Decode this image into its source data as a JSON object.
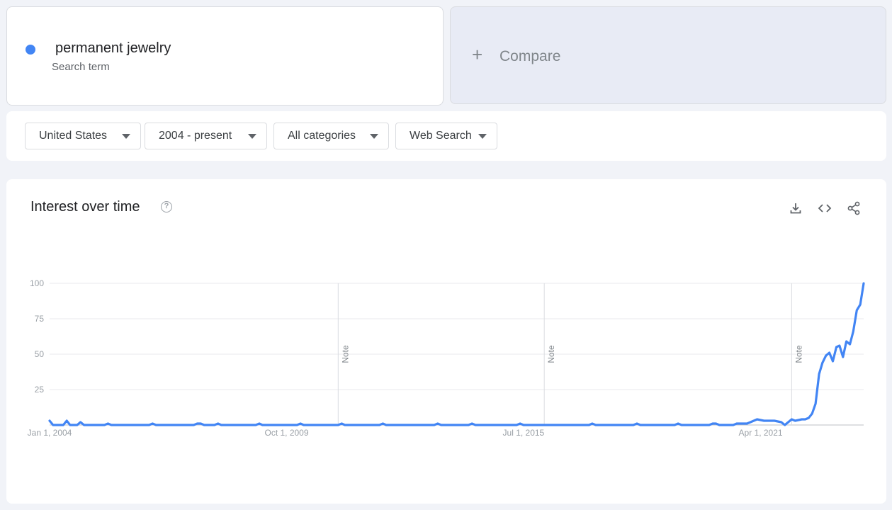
{
  "search_term": {
    "name": "permanent jewelry",
    "subtitle": "Search term",
    "color": "#4285f4"
  },
  "compare": {
    "label": "Compare"
  },
  "filters": {
    "region": "United States",
    "period": "2004 - present",
    "category": "All categories",
    "search_type": "Web Search"
  },
  "chart": {
    "title": "Interest over time",
    "help_icon": "help-circle-icon",
    "tools": [
      "download-icon",
      "embed-code-icon",
      "share-icon"
    ]
  },
  "chart_data": {
    "type": "line",
    "title": "Interest over time",
    "ylim": [
      0,
      100
    ],
    "y_ticks": [
      100,
      75,
      50,
      25
    ],
    "x_tick_labels": [
      "Jan 1, 2004",
      "Oct 1, 2009",
      "Jul 1, 2015",
      "Apr 1, 2021"
    ],
    "x_tick_dates": [
      "2004-01-01",
      "2009-10-01",
      "2015-07-01",
      "2021-04-01"
    ],
    "x_range": [
      "2004-01-01",
      "2023-08-01"
    ],
    "grid": true,
    "notes": [
      {
        "date": "2011-01-01",
        "label": "Note"
      },
      {
        "date": "2016-01-01",
        "label": "Note"
      },
      {
        "date": "2022-01-01",
        "label": "Note"
      }
    ],
    "series": [
      {
        "color": "#4285f4",
        "points": [
          [
            "2004-01-01",
            3
          ],
          [
            "2004-02-01",
            0
          ],
          [
            "2004-05-01",
            0
          ],
          [
            "2004-06-01",
            3
          ],
          [
            "2004-07-01",
            0
          ],
          [
            "2004-09-01",
            0
          ],
          [
            "2004-10-01",
            2
          ],
          [
            "2004-11-01",
            0
          ],
          [
            "2005-05-01",
            0
          ],
          [
            "2005-06-01",
            1
          ],
          [
            "2005-07-01",
            0
          ],
          [
            "2006-06-01",
            0
          ],
          [
            "2006-07-01",
            1
          ],
          [
            "2006-08-01",
            0
          ],
          [
            "2007-07-01",
            0
          ],
          [
            "2007-08-01",
            1
          ],
          [
            "2007-09-01",
            1
          ],
          [
            "2007-10-01",
            0
          ],
          [
            "2008-01-01",
            0
          ],
          [
            "2008-02-01",
            1
          ],
          [
            "2008-03-01",
            0
          ],
          [
            "2009-01-01",
            0
          ],
          [
            "2009-02-01",
            1
          ],
          [
            "2009-03-01",
            0
          ],
          [
            "2010-01-01",
            0
          ],
          [
            "2010-02-01",
            1
          ],
          [
            "2010-03-01",
            0
          ],
          [
            "2011-01-01",
            0
          ],
          [
            "2011-02-01",
            1
          ],
          [
            "2011-03-01",
            0
          ],
          [
            "2012-01-01",
            0
          ],
          [
            "2012-02-01",
            1
          ],
          [
            "2012-03-01",
            0
          ],
          [
            "2013-05-01",
            0
          ],
          [
            "2013-06-01",
            1
          ],
          [
            "2013-07-01",
            0
          ],
          [
            "2014-03-01",
            0
          ],
          [
            "2014-04-01",
            1
          ],
          [
            "2014-05-01",
            0
          ],
          [
            "2015-05-01",
            0
          ],
          [
            "2015-06-01",
            1
          ],
          [
            "2015-07-01",
            0
          ],
          [
            "2017-02-01",
            0
          ],
          [
            "2017-03-01",
            1
          ],
          [
            "2017-04-01",
            0
          ],
          [
            "2018-03-01",
            0
          ],
          [
            "2018-04-01",
            1
          ],
          [
            "2018-05-01",
            0
          ],
          [
            "2019-03-01",
            0
          ],
          [
            "2019-04-01",
            1
          ],
          [
            "2019-05-01",
            0
          ],
          [
            "2020-01-01",
            0
          ],
          [
            "2020-02-01",
            1
          ],
          [
            "2020-03-01",
            1
          ],
          [
            "2020-04-01",
            0
          ],
          [
            "2020-08-01",
            0
          ],
          [
            "2020-09-01",
            1
          ],
          [
            "2020-12-01",
            1
          ],
          [
            "2021-01-01",
            2
          ],
          [
            "2021-03-01",
            4
          ],
          [
            "2021-05-01",
            3
          ],
          [
            "2021-08-01",
            3
          ],
          [
            "2021-10-01",
            2
          ],
          [
            "2021-11-01",
            0
          ],
          [
            "2022-01-01",
            4
          ],
          [
            "2022-02-01",
            3
          ],
          [
            "2022-04-01",
            4
          ],
          [
            "2022-05-01",
            4
          ],
          [
            "2022-06-01",
            5
          ],
          [
            "2022-07-01",
            8
          ],
          [
            "2022-08-01",
            15
          ],
          [
            "2022-09-01",
            36
          ],
          [
            "2022-10-01",
            44
          ],
          [
            "2022-11-01",
            49
          ],
          [
            "2022-12-01",
            51
          ],
          [
            "2023-01-01",
            45
          ],
          [
            "2023-02-01",
            55
          ],
          [
            "2023-03-01",
            56
          ],
          [
            "2023-04-01",
            48
          ],
          [
            "2023-05-01",
            59
          ],
          [
            "2023-06-01",
            57
          ],
          [
            "2023-07-01",
            66
          ],
          [
            "2023-08-01",
            81
          ],
          [
            "2023-09-01",
            85
          ],
          [
            "2023-10-01",
            100
          ]
        ]
      }
    ]
  }
}
